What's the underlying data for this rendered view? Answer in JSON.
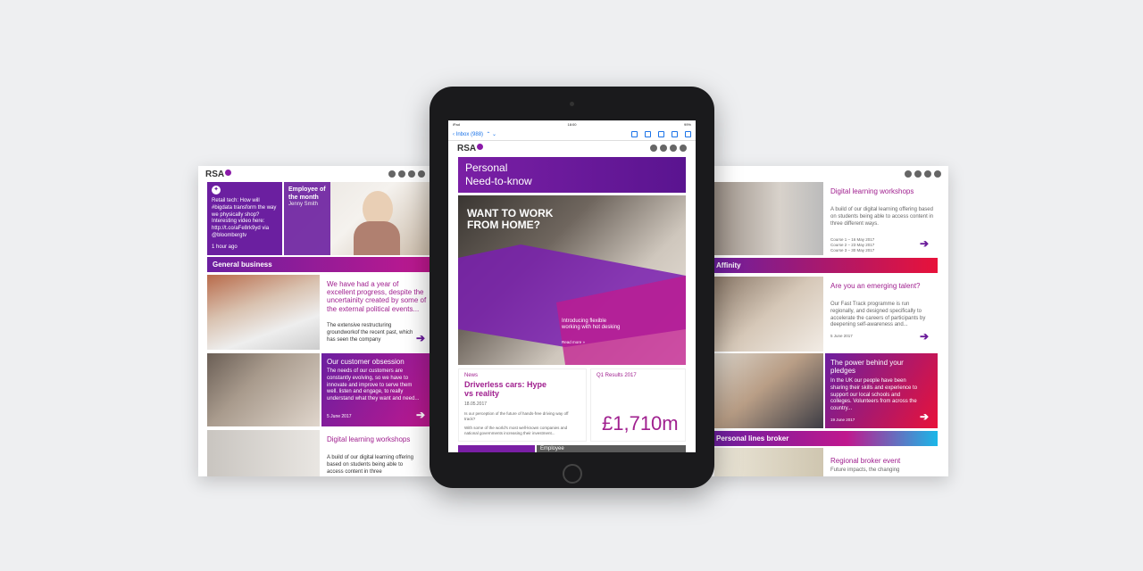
{
  "left": {
    "logo": "RSA",
    "tweet": {
      "text": "Retail tech: How will #bigdata transform the way we physically shop? Interesting video here: http://t.co/aFe8rk9yd via @bloombergtv",
      "time": "1 hour ago"
    },
    "employee": {
      "title": "Employee of the month",
      "name": "Jenny Smith"
    },
    "section": "General business",
    "article1": {
      "title": "We have had a year of excellent progress, despite the uncertainity created by some of the external political events...",
      "body": "The extensive restructuring groundworkof the recent past, which has seen the company"
    },
    "article2": {
      "title": "Our customer obsession",
      "body": "The needs of our customers are constantly evolving, so we have to innovate and improve to serve them well. listen and engage, to really understand what they want and need...",
      "date": "5 June 2017"
    },
    "article3": {
      "title": "Digital learning workshops",
      "body": "A build of our digital learning offering based on students being able to access content in three"
    }
  },
  "ipad": {
    "status": {
      "left": "iPad",
      "time": "18:00",
      "right": "99%"
    },
    "inbox": "Inbox (988)",
    "logo": "RSA",
    "banner": {
      "line1": "Personal",
      "line2": "Need-to-know"
    },
    "hero": {
      "headline": "WANT TO WORK FROM HOME?",
      "caption": "Introducing flexible working with hot desking",
      "more": "Read more »"
    },
    "news": {
      "label": "News",
      "title": "Driverless cars: Hype vs reality",
      "date": "18.05.2017",
      "body1": "Is our perception of the future of hands-free driving way off track?",
      "body2": "With some of the world's most well-known companies and national governments increasing their investment..."
    },
    "results": {
      "label": "Q1 Results 2017",
      "value": "£1,710m"
    },
    "footer_employee": "Employee"
  },
  "right": {
    "article1": {
      "title": "Digital learning workshops",
      "body": "A build of our digital learning offering based on students being able to access content in three different ways.",
      "courses": [
        "Course 1 – 16 May 2017",
        "Course 2 – 23 May 2017",
        "Course 3 – 30 May 2017"
      ]
    },
    "section1": "Affinity",
    "article2": {
      "title": "Are you an emerging talent?",
      "body": "Our Fast Track programme is run regionally, and designed specifically to accelerate the careers of participants by deepening self-awareness and...",
      "date": "5 June 2017"
    },
    "article3": {
      "title": "The power behind your pledges",
      "body": "In the UK our people have been sharing their skills and experience to support our local schools and colleges. Volunteers from across the country...",
      "date": "19 June 2017"
    },
    "section2": "Personal lines broker",
    "article4": {
      "title": "Regional broker event",
      "body": "Future impacts, the changing"
    }
  }
}
